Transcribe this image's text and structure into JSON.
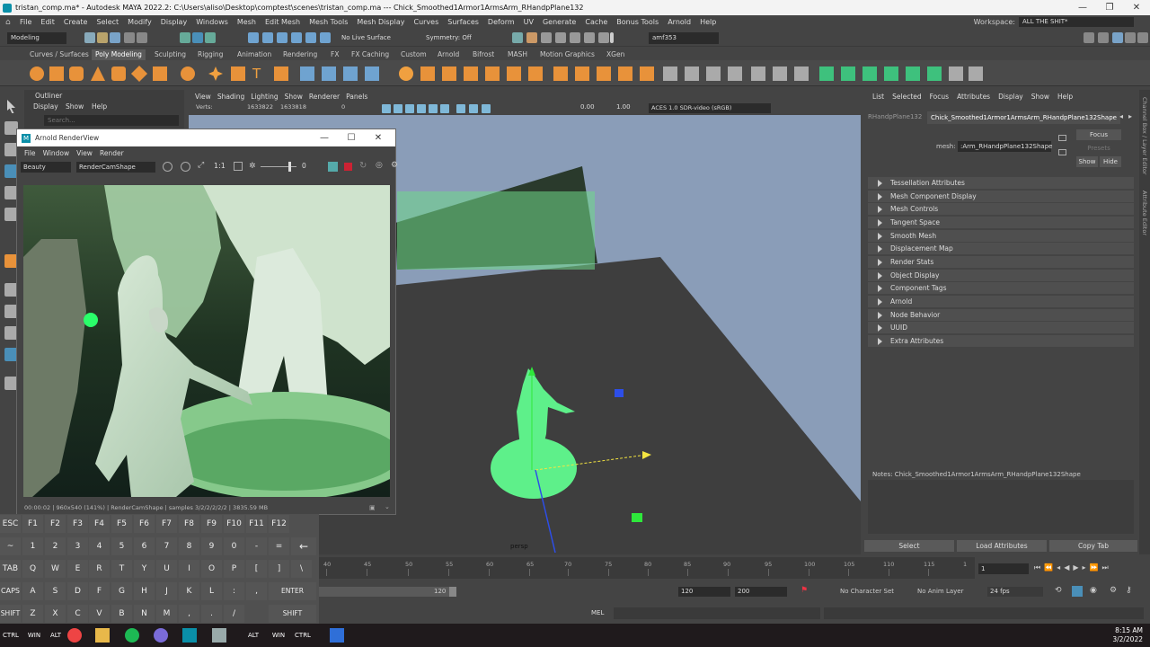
{
  "titlebar": {
    "title": "tristan_comp.ma* - Autodesk MAYA 2022.2: C:\\Users\\aliso\\Desktop\\comptest\\scenes\\tristan_comp.ma  ---  Chick_Smoothed1Armor1ArmsArm_RHandpPlane132"
  },
  "menubar": {
    "items": [
      "File",
      "Edit",
      "Create",
      "Select",
      "Modify",
      "Display",
      "Windows",
      "Mesh",
      "Edit Mesh",
      "Mesh Tools",
      "Mesh Display",
      "Curves",
      "Surfaces",
      "Deform",
      "UV",
      "Generate",
      "Cache",
      "Bonus Tools",
      "Arnold",
      "Help"
    ],
    "workspace_label": "Workspace:",
    "workspace_value": "ALL THE SHIT*"
  },
  "statusline": {
    "mode": "Modeling",
    "live_surface": "No Live Surface",
    "symmetry": "Symmetry: Off",
    "user": "amf353"
  },
  "shelf": {
    "tabs": [
      "Curves / Surfaces",
      "Poly Modeling",
      "Sculpting",
      "Rigging",
      "Animation",
      "Rendering",
      "FX",
      "FX Caching",
      "Custom",
      "Arnold",
      "Bifrost",
      "MASH",
      "Motion Graphics",
      "XGen"
    ],
    "active_tab": "Poly Modeling"
  },
  "outliner": {
    "title": "Outliner",
    "menu": [
      "Display",
      "Show",
      "Help"
    ],
    "search_placeholder": "Search..."
  },
  "viewport": {
    "menu": [
      "View",
      "Shading",
      "Lighting",
      "Show",
      "Renderer",
      "Panels"
    ],
    "verts_label": "Verts:",
    "verts_values": [
      "1633822",
      "1633818",
      "0"
    ],
    "exposure": "0.00",
    "gamma": "1.00",
    "color_space": "ACES 1.0 SDR-video (sRGB)",
    "camera_label": "persp"
  },
  "renderview": {
    "title": "Arnold RenderView",
    "menu": [
      "File",
      "Window",
      "View",
      "Render"
    ],
    "aov": "Beauty",
    "camera": "RenderCamShape",
    "zoom": "1:1",
    "exposure": "0",
    "status": "00:00:02 | 960x540 (141%) | RenderCamShape | samples 3/2/2/2/2/2 | 3835.59 MB"
  },
  "attribute_editor": {
    "menu": [
      "List",
      "Selected",
      "Focus",
      "Attributes",
      "Display",
      "Show",
      "Help"
    ],
    "tab_prev": "RHandpPlane132",
    "tab_active": "Chick_Smoothed1Armor1ArmsArm_RHandpPlane132Shape",
    "mesh_label": "mesh:",
    "mesh_value": ":Arm_RHandpPlane132Shape",
    "focus_btn": "Focus",
    "presets_btn": "Presets",
    "show_btn": "Show",
    "hide_btn": "Hide",
    "sections": [
      "Tessellation Attributes",
      "Mesh Component Display",
      "Mesh Controls",
      "Tangent Space",
      "Smooth Mesh",
      "Displacement Map",
      "Render Stats",
      "Object Display",
      "Component Tags",
      "Arnold",
      "Node Behavior",
      "UUID",
      "Extra Attributes"
    ],
    "notes": "Notes:  Chick_Smoothed1Armor1ArmsArm_RHandpPlane132Shape",
    "buttons": [
      "Select",
      "Load Attributes",
      "Copy Tab"
    ],
    "side_tabs": [
      "Channel Box / Layer Editor",
      "Attribute Editor"
    ]
  },
  "timeline": {
    "ticks": [
      "40",
      "45",
      "50",
      "55",
      "60",
      "65",
      "70",
      "75",
      "80",
      "85",
      "90",
      "95",
      "100",
      "105",
      "110",
      "115",
      "1"
    ],
    "current_frame": "1",
    "range_end_inner": "120",
    "range_end": "120",
    "range_max": "200",
    "character_set": "No Character Set",
    "anim_layer": "No Anim Layer",
    "fps": "24 fps"
  },
  "cmdline": {
    "label": "MEL"
  },
  "keyboard": {
    "row1": [
      "ESC",
      "F1",
      "F2",
      "F3",
      "F4",
      "F5",
      "F6",
      "F7",
      "F8",
      "F9",
      "F10",
      "F11",
      "F12"
    ],
    "row2": [
      "~",
      "1",
      "2",
      "3",
      "4",
      "5",
      "6",
      "7",
      "8",
      "9",
      "0",
      "-",
      "=",
      "←"
    ],
    "row3": [
      "TAB",
      "Q",
      "W",
      "E",
      "R",
      "T",
      "Y",
      "U",
      "I",
      "O",
      "P",
      "[",
      "]",
      "\\"
    ],
    "row4": [
      "CAPS",
      "A",
      "S",
      "D",
      "F",
      "G",
      "H",
      "J",
      "K",
      "L",
      ":",
      ",",
      "ENTER"
    ],
    "row5": [
      "SHIFT",
      "Z",
      "X",
      "C",
      "V",
      "B",
      "N",
      "M",
      ",",
      ".",
      "/",
      "SHIFT"
    ]
  },
  "taskbar": {
    "left_keys": [
      "CTRL",
      "WIN",
      "ALT"
    ],
    "mid_keys": [
      "ALT",
      "WIN",
      "CTRL"
    ],
    "time": "8:15 AM",
    "date": "3/2/2022"
  },
  "colors": {
    "accent_green": "#5ef08a",
    "maya_teal": "#0a8fa8",
    "viewport_bg": "#8a9db8",
    "grid_plane": "#3e3e3e"
  }
}
